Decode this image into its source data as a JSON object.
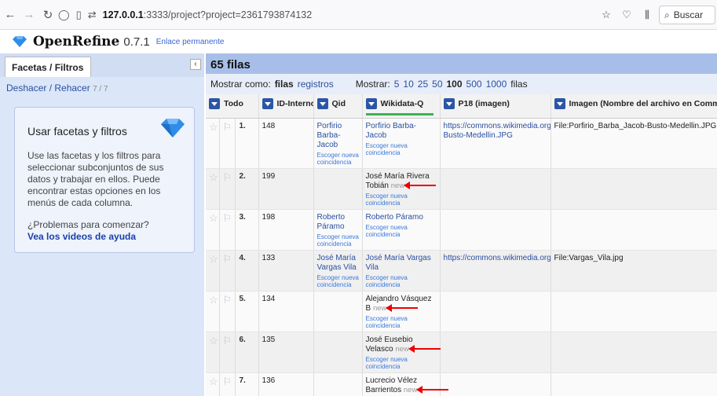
{
  "browser": {
    "url_host": "127.0.0.1",
    "url_rest": ":3333/project?project=2361793874132",
    "search_label": "Buscar"
  },
  "app": {
    "name": "OpenRefine",
    "version": "0.7.1",
    "permalink": "Enlace permanente",
    "brand_color": "#2f8ce8"
  },
  "left": {
    "tab_label": "Facetas / Filtros",
    "undo_label": "Deshacer / Rehacer",
    "undo_count": "7 / 7",
    "help_title": "Usar facetas y filtros",
    "help_text": "Use las facetas y los filtros para seleccionar subconjuntos de sus datos y trabajar en ellos. Puede encontrar estas opciones en los menús de cada columna.",
    "help_question": "¿Problemas para comenzar?",
    "help_link": "Vea los videos de ayuda"
  },
  "main": {
    "rows_title": "65 filas",
    "show_as_label": "Mostrar como:",
    "mode_rows": "filas",
    "mode_records": "registros",
    "show_label": "Mostrar:",
    "counts": [
      "5",
      "10",
      "25",
      "50",
      "100",
      "500",
      "1000"
    ],
    "selected_count": "100",
    "rows_suffix": "filas"
  },
  "columns": {
    "all": "Todo",
    "id": "ID-Interno",
    "qid": "Qid",
    "wikidata": "Wikidata-Q",
    "p18": "P18 (imagen)",
    "image": "Imagen (Nombre del archivo en Commons"
  },
  "labels": {
    "choose_new": "Escoger nueva coincidencia",
    "new_tag": "new"
  },
  "rows": [
    {
      "n": "1.",
      "id": "148",
      "qid": "Porfirio Barba-Jacob",
      "wiki": "Porfirio Barba-Jacob",
      "wiki_matched": true,
      "p18": "https://commons.wikimedia.org/wiki/File:Porfirio_Barba_Jacob-Busto-Medellin.JPG",
      "image": "File:Porfirio_Barba_Jacob-Busto-Medellin.JPG"
    },
    {
      "n": "2.",
      "id": "199",
      "qid": "",
      "wiki": "José María Rivera Tobián",
      "wiki_matched": false,
      "p18": "",
      "image": ""
    },
    {
      "n": "3.",
      "id": "198",
      "qid": "Roberto Páramo",
      "wiki": "Roberto Páramo",
      "wiki_matched": true,
      "p18": "",
      "image": ""
    },
    {
      "n": "4.",
      "id": "133",
      "qid": "José María Vargas Vila",
      "wiki": "José María Vargas Vila",
      "wiki_matched": true,
      "p18": "https://commons.wikimedia.org/wiki/File:Vargas_Vila.jpg",
      "image": "File:Vargas_Vila.jpg"
    },
    {
      "n": "5.",
      "id": "134",
      "qid": "",
      "wiki": "Alejandro Vásquez B",
      "wiki_matched": false,
      "p18": "",
      "image": ""
    },
    {
      "n": "6.",
      "id": "135",
      "qid": "",
      "wiki": "José Eusebio Velasco",
      "wiki_matched": false,
      "p18": "",
      "image": ""
    },
    {
      "n": "7.",
      "id": "136",
      "qid": "",
      "wiki": "Lucrecio Vélez Barrientos",
      "wiki_matched": false,
      "p18": "",
      "image": ""
    }
  ]
}
